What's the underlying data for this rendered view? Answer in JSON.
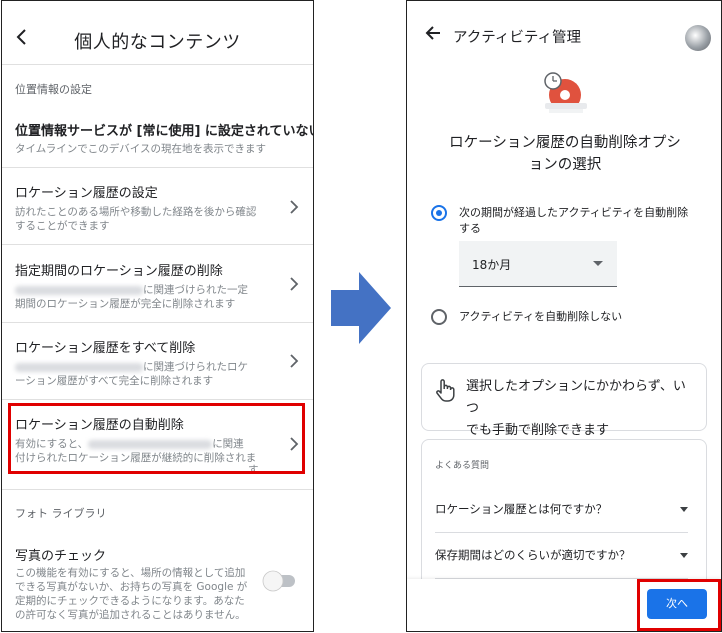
{
  "left": {
    "header_title": "個人的なコンテンツ",
    "section_location": "位置情報の設定",
    "items": [
      {
        "title": "位置情報サービスが [常に使用] に設定されていない",
        "sub": "タイムラインでこのデバイスの現在地を表示できます"
      },
      {
        "title": "ロケーション履歴の設定",
        "sub1": "訪れたことのある場所や移動した経路を後から確認",
        "sub2": "することができます"
      },
      {
        "title": "指定期間のロケーション履歴の削除",
        "sub1": "に関連づけられた一定",
        "sub2": "期間のロケーション履歴が完全に削除されます"
      },
      {
        "title": "ロケーション履歴をすべて削除",
        "sub1": "に関連づけられたロケ",
        "sub2": "ーション履歴がすべて完全に削除されます"
      },
      {
        "title": "ロケーション履歴の自動削除",
        "sub1a": "有効にすると、",
        "sub1b": "に関連",
        "sub2": "付けられたロケーション履歴が継続的に削除されま",
        "sub3": "す"
      }
    ],
    "section_photo": "フォト ライブラリ",
    "photo_item": {
      "title": "写真のチェック",
      "lines": [
        "この機能を有効にすると、場所の情報として追加",
        "できる写真がないか、お持ちの写真を Google が",
        "定期的にチェックできるようになります。あなた",
        "の許可なく写真が追加されることはありません。"
      ]
    }
  },
  "right": {
    "header_title": "アクティビティ管理",
    "heading_line1": "ロケーション履歴の自動削除オプシ",
    "heading_line2": "ョンの選択",
    "option1_line1": "次の期間が経過したアクティビティを自動削除",
    "option1_line2": "する",
    "select_value": "18か月",
    "option2": "アクティビティを自動削除しない",
    "info_line1": "選択したオプションにかかわらず、いつ",
    "info_line2": "でも手動で削除できます",
    "faq_label": "よくある質問",
    "faq": [
      "ロケーション履歴とは何ですか？",
      "保存期間はどのくらいが適切ですか？"
    ],
    "next_button": "次へ"
  },
  "colors": {
    "accent": "#1a73e8",
    "highlight": "#e00000",
    "arrow": "#4472c4"
  }
}
